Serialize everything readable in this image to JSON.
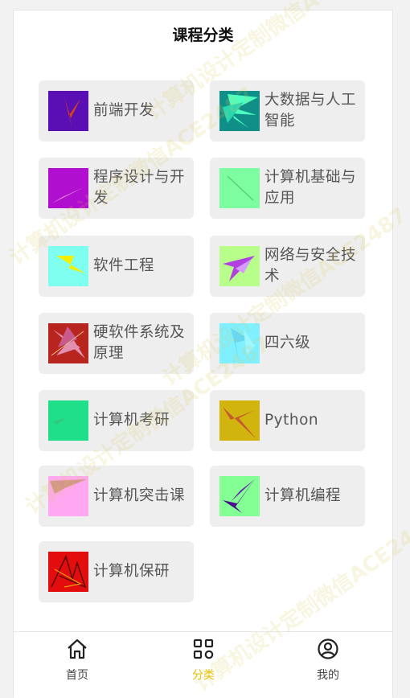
{
  "header": {
    "title": "课程分类"
  },
  "categories": [
    {
      "label": "前端开发",
      "thumb_bg": "#5a0fb4",
      "icon": "abstract-thumbnail-icon"
    },
    {
      "label": "大数据与人工智能",
      "thumb_bg": "#0f8f88",
      "icon": "abstract-thumbnail-icon"
    },
    {
      "label": "程序设计与开发",
      "thumb_bg": "#b10fcf",
      "icon": "abstract-thumbnail-icon"
    },
    {
      "label": "计算机基础与应用",
      "thumb_bg": "#7dfca0",
      "icon": "abstract-thumbnail-icon"
    },
    {
      "label": "软件工程",
      "thumb_bg": "#7ffff0",
      "icon": "abstract-thumbnail-icon"
    },
    {
      "label": "网络与安全技术",
      "thumb_bg": "#b7ff8a",
      "icon": "abstract-thumbnail-icon"
    },
    {
      "label": "硬软件系统及原理",
      "thumb_bg": "#b8251e",
      "icon": "abstract-thumbnail-icon"
    },
    {
      "label": "四六级",
      "thumb_bg": "#7ff0ff",
      "icon": "abstract-thumbnail-icon"
    },
    {
      "label": "计算机考研",
      "thumb_bg": "#1fdf8a",
      "icon": "abstract-thumbnail-icon"
    },
    {
      "label": "Python",
      "thumb_bg": "#d1b40d",
      "icon": "abstract-thumbnail-icon"
    },
    {
      "label": "计算机突击课",
      "thumb_bg": "#ffa8f1",
      "icon": "abstract-thumbnail-icon"
    },
    {
      "label": "计算机编程",
      "thumb_bg": "#84ff93",
      "icon": "abstract-thumbnail-icon"
    },
    {
      "label": "计算机保研",
      "thumb_bg": "#e40d0d",
      "icon": "abstract-thumbnail-icon"
    }
  ],
  "tabbar": {
    "items": [
      {
        "label": "首页",
        "icon": "home-icon",
        "active": false
      },
      {
        "label": "分类",
        "icon": "category-grid-icon",
        "active": true
      },
      {
        "label": "我的",
        "icon": "user-profile-icon",
        "active": false
      }
    ],
    "active_color": "#e6c200"
  },
  "watermark": {
    "text": "计算机设计定制微信ACE2487"
  }
}
